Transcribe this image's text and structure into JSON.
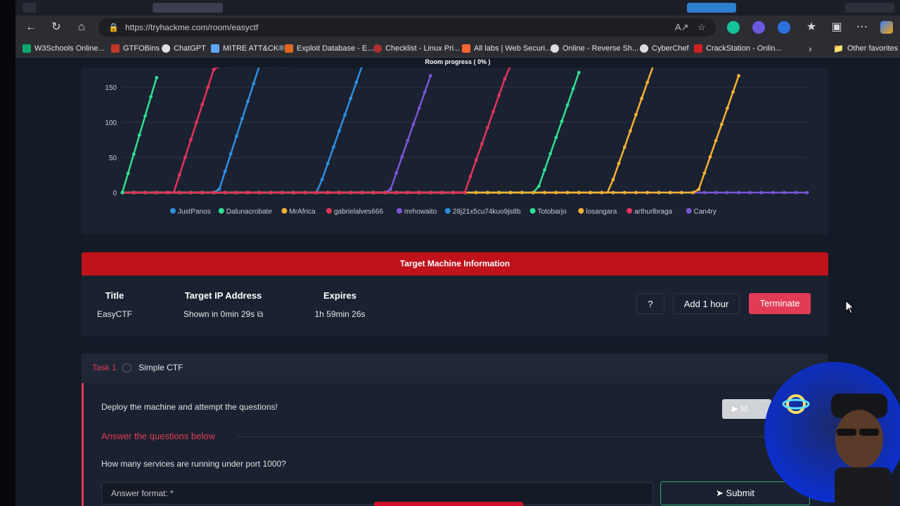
{
  "browser": {
    "url": "https://tryhackme.com/room/easyctf",
    "bookmarks": [
      {
        "label": "W3Schools Online...",
        "color": "#04aa6d"
      },
      {
        "label": "GTFOBins",
        "color": "#c0392b"
      },
      {
        "label": "ChatGPT",
        "color": "#e0e0e0"
      },
      {
        "label": "MITRE ATT&CK®",
        "color": "#5fa8ff"
      },
      {
        "label": "Exploit Database - E...",
        "color": "#e06820"
      },
      {
        "label": "Checklist - Linux Pri...",
        "color": "#b03030"
      },
      {
        "label": "All labs | Web Securi...",
        "color": "#ff6633"
      },
      {
        "label": "Online - Reverse Sh...",
        "color": "#dddddd"
      },
      {
        "label": "CyberChef",
        "color": "#dddddd"
      },
      {
        "label": "CrackStation - Onlin...",
        "color": "#d02020"
      }
    ],
    "other_favorites": "Other favorites",
    "icons": [
      "back-icon",
      "refresh-icon",
      "home-icon",
      "lock-icon",
      "read-aloud-icon",
      "star-icon",
      "grammarly-icon",
      "copilot-icon",
      "favorites-icon",
      "collections-icon",
      "more-icon"
    ]
  },
  "room": {
    "progress_label": "Room progress ( 0% )"
  },
  "chart_data": {
    "type": "line",
    "yticks": [
      "0",
      "50",
      "100",
      "150"
    ],
    "ylim": [
      0,
      180
    ],
    "grid": true,
    "legend_position": "bottom",
    "series": [
      {
        "name": "JustPanos",
        "color": "#2d8fe0",
        "flat_until": 0.14,
        "climb_start": 0.14,
        "climb_end": 0.2
      },
      {
        "name": "Dalunacrobate",
        "color": "#2ee08f",
        "flat_until": 0.0,
        "climb_start": 0.0,
        "climb_end": 0.055
      },
      {
        "name": "MrAfrica",
        "color": "#f5b133",
        "flat_until": 0.71,
        "climb_start": 0.71,
        "climb_end": 0.775
      },
      {
        "name": "gabrielalves666",
        "color": "#e6335a",
        "flat_until": 0.075,
        "climb_start": 0.075,
        "climb_end": 0.135,
        "cap_end": 0.245
      },
      {
        "name": "mrhowaito",
        "color": "#7b55d6",
        "flat_until": 0.39,
        "climb_start": 0.39,
        "climb_end": 0.455
      },
      {
        "name": "28j21x5cu74kuo9js8b",
        "color": "#2d8fe0",
        "flat_until": 0.285,
        "climb_start": 0.285,
        "climb_end": 0.35
      },
      {
        "name": "Totobarjo",
        "color": "#2ee08f",
        "flat_until": 0.605,
        "climb_start": 0.605,
        "climb_end": 0.67
      },
      {
        "name": "losangara",
        "color": "#f5b133",
        "flat_until": 0.84,
        "climb_start": 0.84,
        "climb_end": 0.905
      },
      {
        "name": "arthurlbraga",
        "color": "#e6335a",
        "flat_until": 0.5,
        "climb_start": 0.5,
        "climb_end": 0.565
      },
      {
        "name": "Can4ry",
        "color": "#7b55d6",
        "flat_until": 1.0,
        "climb_start": 1.1,
        "climb_end": 1.1
      }
    ]
  },
  "target_machine": {
    "header": "Target Machine Information",
    "columns": [
      {
        "heading": "Title",
        "value": "EasyCTF"
      },
      {
        "heading": "Target IP Address",
        "value": "Shown in 0min 29s"
      },
      {
        "heading": "Expires",
        "value": "1h 59min 26s"
      }
    ],
    "help_label": "?",
    "add_hour_label": "Add 1 hour",
    "terminate_label": "Terminate"
  },
  "task": {
    "label": "Task 1",
    "title": "Simple CTF",
    "description": "Deploy the machine and attempt the questions!",
    "start_label": "St",
    "answer_heading": "Answer the questions below",
    "question": "How many services are running under port 1000?",
    "answer_placeholder": "Answer format: *",
    "submit_label": "Submit"
  }
}
